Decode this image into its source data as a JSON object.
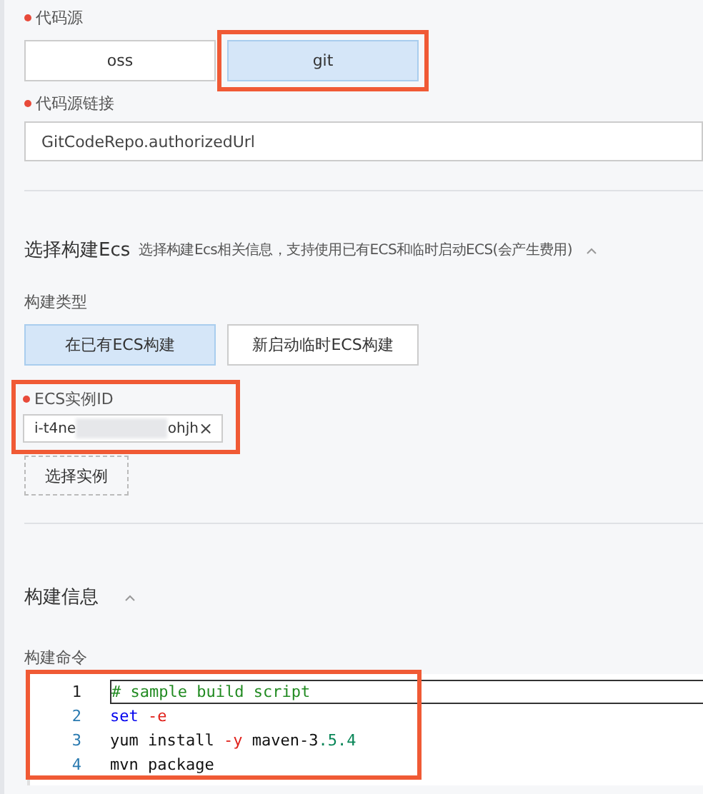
{
  "code_source": {
    "label": "代码源",
    "required": true,
    "options": [
      {
        "label": "oss",
        "selected": false,
        "highlighted": false
      },
      {
        "label": "git",
        "selected": true,
        "highlighted": true
      }
    ]
  },
  "code_source_url": {
    "label": "代码源链接",
    "required": true,
    "value": "GitCodeRepo.authorizedUrl"
  },
  "ecs_section": {
    "title": "选择构建Ecs",
    "description": "选择构建Ecs相关信息，支持使用已有ECS和临时启动ECS(会产生费用)",
    "expanded": true,
    "build_type": {
      "label": "构建类型",
      "options": [
        {
          "label": "在已有ECS构建",
          "selected": true
        },
        {
          "label": "新启动临时ECS构建",
          "selected": false
        }
      ]
    },
    "instance": {
      "label": "ECS实例ID",
      "required": true,
      "highlighted": true,
      "value_start": "i-t4ne",
      "value_end": "ohjh",
      "remove": "×"
    },
    "select_button": "选择实例"
  },
  "build_section": {
    "title": "构建信息",
    "expanded": true,
    "command": {
      "label": "构建命令",
      "highlighted": true,
      "lines": [
        {
          "number": "1",
          "current": true,
          "tokens": [
            {
              "text": "# sample build script",
              "kind": "comment"
            }
          ]
        },
        {
          "number": "2",
          "current": false,
          "tokens": [
            {
              "text": "set",
              "kind": "keyword"
            },
            {
              "text": " -e",
              "kind": "flag"
            }
          ]
        },
        {
          "number": "3",
          "current": false,
          "tokens": [
            {
              "text": "yum install ",
              "kind": "plain"
            },
            {
              "text": "-y",
              "kind": "flag"
            },
            {
              "text": " maven-3",
              "kind": "plain"
            },
            {
              "text": ".5.4",
              "kind": "number"
            }
          ]
        },
        {
          "number": "4",
          "current": false,
          "tokens": [
            {
              "text": "mvn package",
              "kind": "plain"
            }
          ]
        }
      ]
    }
  }
}
